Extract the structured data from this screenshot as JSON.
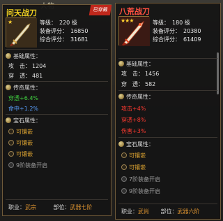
{
  "background": {
    "text": "人物"
  },
  "left_panel": {
    "title": "问天战刀",
    "badge": "已穿戴",
    "stars": "★",
    "stats": [
      {
        "label": "等级：",
        "value": "220 级"
      },
      {
        "label": "装备评分：",
        "value": "16850"
      },
      {
        "label": "综合评分：",
        "value": "31681"
      }
    ],
    "basic": {
      "header": "基础属性：",
      "rows": [
        {
          "label": "攻　击：",
          "value": "1204"
        },
        {
          "label": "穿　透：",
          "value": "481"
        }
      ]
    },
    "legend": {
      "header": "传奇属性：",
      "rows": [
        "穿透+6.4%",
        "命中+1.2%"
      ]
    },
    "gems": {
      "header": "宝石属性：",
      "rows": [
        "可镶嵌",
        "可镶嵌",
        "可镶嵌",
        "9阶装备开启"
      ]
    },
    "footer": {
      "job_label": "职业：",
      "job_value": "武宗",
      "part_label": "部位：",
      "part_value": "武器七阶"
    }
  },
  "right_panel": {
    "title": "八荒战刀",
    "stars": "★★★",
    "stats": [
      {
        "label": "等级：",
        "value": "180 级"
      },
      {
        "label": "装备评分：",
        "value": "20380"
      },
      {
        "label": "综合评分：",
        "value": "61409"
      }
    ],
    "basic": {
      "header": "基础属性：",
      "rows": [
        {
          "label": "攻　击：",
          "value": "1456"
        },
        {
          "label": "穿　透：",
          "value": "582"
        }
      ]
    },
    "legend": {
      "header": "传奇属性：",
      "rows": [
        "攻击+4%",
        "穿透+8%",
        "伤害+3%"
      ]
    },
    "gems": {
      "header": "宝石属性：",
      "rows": [
        "可镶嵌",
        "可镶嵌",
        "7阶装备开启",
        "9阶装备开启"
      ]
    },
    "footer": {
      "job_label": "职业：",
      "job_value": "武尚",
      "part_label": "部位：",
      "part_value": "武器六阶"
    }
  }
}
